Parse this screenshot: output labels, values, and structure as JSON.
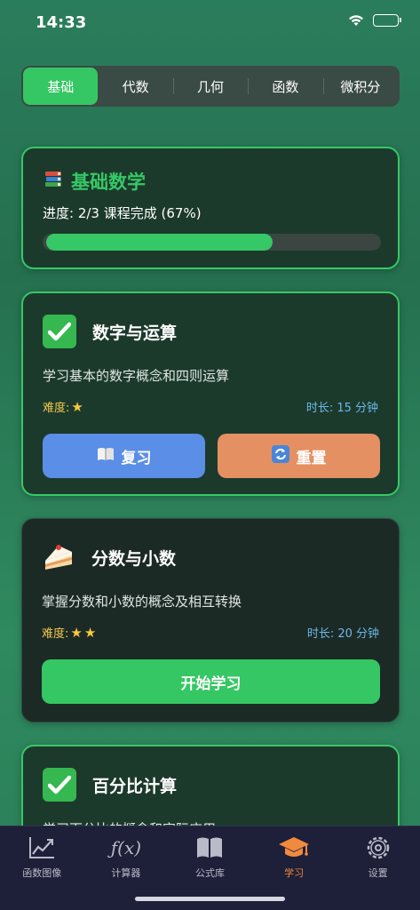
{
  "status": {
    "time": "14:33"
  },
  "tabs": [
    {
      "label": "基础",
      "active": true
    },
    {
      "label": "代数",
      "active": false
    },
    {
      "label": "几何",
      "active": false
    },
    {
      "label": "函数",
      "active": false
    },
    {
      "label": "微积分",
      "active": false
    }
  ],
  "hero": {
    "icon": "books-icon",
    "title": "基础数学",
    "progress_text": "进度: 2/3 课程完成 (67%)",
    "progress_fraction": 0.67
  },
  "lessons": [
    {
      "icon": "check-icon",
      "title": "数字与运算",
      "description": "学习基本的数字概念和四则运算",
      "difficulty_label": "难度:",
      "difficulty_stars": 1,
      "duration": "时长: 15 分钟",
      "review_label": "复习",
      "reset_label": "重置"
    },
    {
      "icon": "cake-icon",
      "title": "分数与小数",
      "description": "掌握分数和小数的概念及相互转换",
      "difficulty_label": "难度:",
      "difficulty_stars": 2,
      "duration": "时长: 20 分钟",
      "start_label": "开始学习"
    },
    {
      "icon": "check-icon",
      "title": "百分比计算",
      "description": "学习百分比的概念和实际应用"
    }
  ],
  "tabbar": [
    {
      "label": "函数图像",
      "icon": "chart-icon",
      "active": false
    },
    {
      "label": "计算器",
      "icon": "function-icon",
      "active": false
    },
    {
      "label": "公式库",
      "icon": "book-icon",
      "active": false
    },
    {
      "label": "学习",
      "icon": "graduation-cap-icon",
      "active": true
    },
    {
      "label": "设置",
      "icon": "gear-icon",
      "active": false
    }
  ],
  "colors": {
    "accent": "#36c866",
    "tab_active": "#f08a3e",
    "review": "#5b8ee6",
    "reset": "#e59063"
  }
}
